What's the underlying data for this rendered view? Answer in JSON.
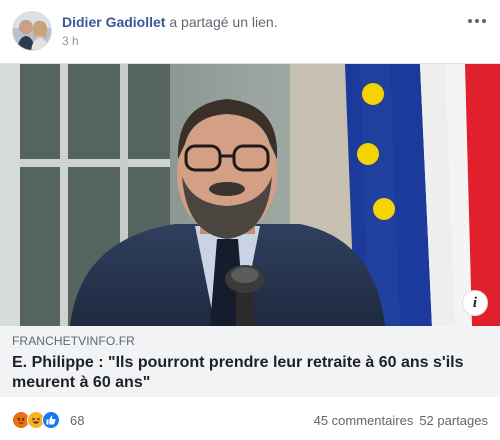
{
  "post": {
    "author": "Didier Gadiollet",
    "action": "a partagé un lien.",
    "time": "3 h"
  },
  "link": {
    "domain": "FRANCHETVINFO.FR",
    "title": "E. Philippe : \"Ils pourront prendre leur retraite à 60 ans s'ils meurent à 60 ans\"",
    "info_icon": "i"
  },
  "footer": {
    "reaction_count": "68",
    "comments": "45 commentaires",
    "shares": "52 partages"
  },
  "icons": {
    "reactions": [
      "angry-reaction-icon",
      "haha-reaction-icon",
      "like-reaction-icon"
    ],
    "more": "ellipsis-icon"
  },
  "colors": {
    "author_link": "#385898",
    "card_meta_bg": "#f2f3f5",
    "like_blue": "#1877f2",
    "angry_orange": "#e9710f",
    "haha_yellow": "#f7b125"
  }
}
